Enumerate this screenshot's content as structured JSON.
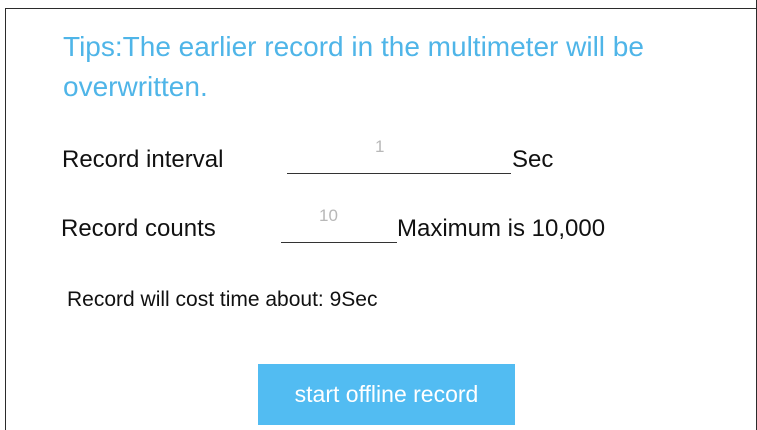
{
  "tips": {
    "text": "Tips:The earlier record in the multimeter will be overwritten."
  },
  "record_interval": {
    "label": "Record interval",
    "value": "1",
    "unit": "Sec"
  },
  "record_counts": {
    "label": "Record counts",
    "value": "10",
    "limit_text": "Maximum is 10,000"
  },
  "estimate": {
    "text": "Record will cost time about: 9Sec"
  },
  "actions": {
    "start_label": "start offline record"
  },
  "colors": {
    "tips_text": "#4fb5e8",
    "button_background": "#52bcf2",
    "button_text": "#ffffff",
    "placeholder_text": "#b8b8b8"
  }
}
